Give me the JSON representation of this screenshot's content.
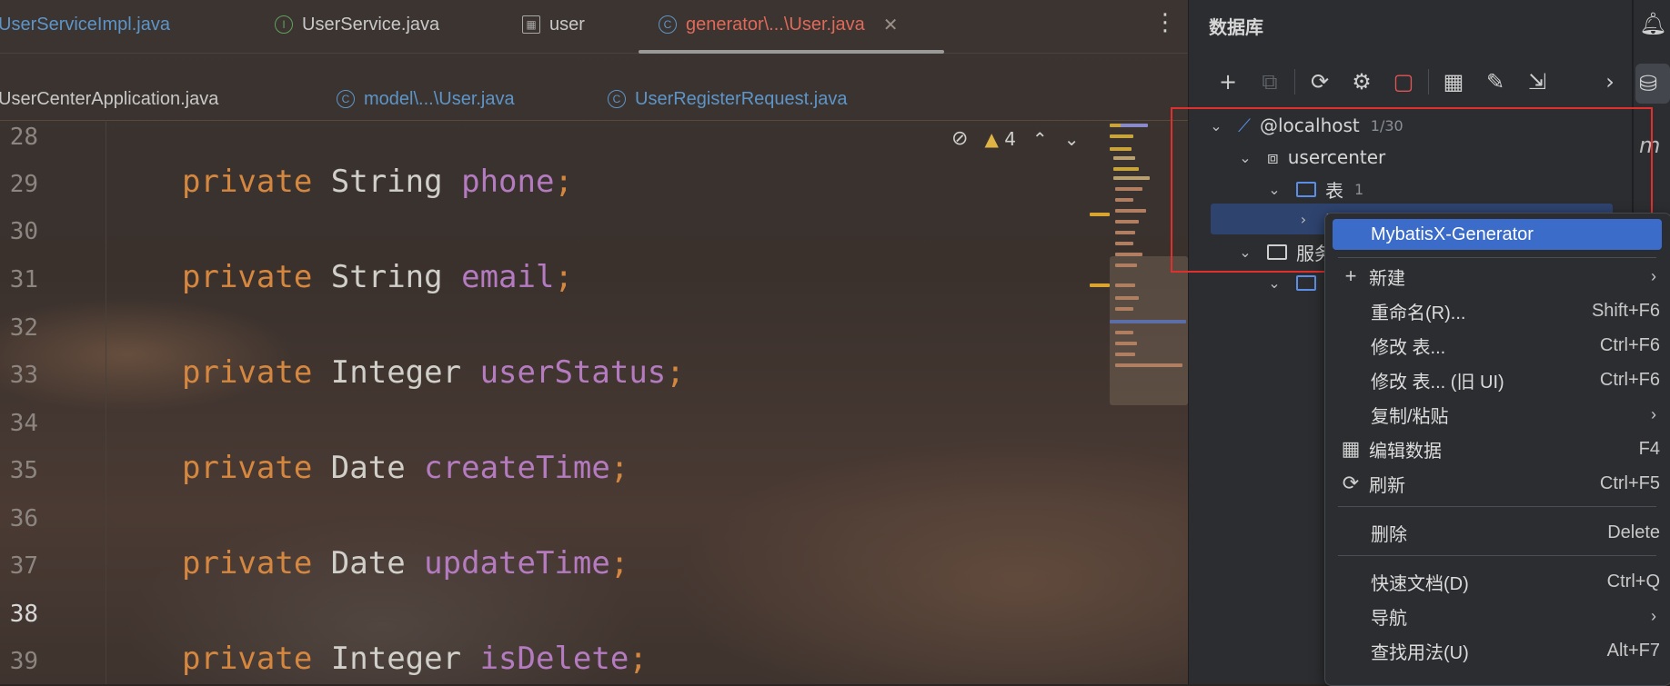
{
  "editor": {
    "tabs_row1": [
      {
        "label": "UserServiceImpl.java",
        "icon": "class-icon"
      },
      {
        "label": "UserService.java",
        "icon": "interface-icon"
      },
      {
        "label": "user",
        "icon": "table-icon"
      },
      {
        "label": "generator\\...\\User.java",
        "icon": "class-icon",
        "active": true
      }
    ],
    "tabs_row2": [
      {
        "label": "UserCenterApplication.java"
      },
      {
        "label": "model\\...\\User.java",
        "icon": "class-icon"
      },
      {
        "label": "UserRegisterRequest.java",
        "icon": "class-icon"
      }
    ],
    "inspection": {
      "warnings": "4"
    },
    "lines": [
      {
        "no": "28",
        "code": null
      },
      {
        "no": "29",
        "kw": "private",
        "type": "String",
        "field": "phone"
      },
      {
        "no": "30",
        "code": null
      },
      {
        "no": "31",
        "kw": "private",
        "type": "String",
        "field": "email"
      },
      {
        "no": "32",
        "code": null
      },
      {
        "no": "33",
        "kw": "private",
        "type": "Integer",
        "field": "userStatus"
      },
      {
        "no": "34",
        "code": null
      },
      {
        "no": "35",
        "kw": "private",
        "type": "Date",
        "field": "createTime"
      },
      {
        "no": "36",
        "code": null
      },
      {
        "no": "37",
        "kw": "private",
        "type": "Date",
        "field": "updateTime"
      },
      {
        "no": "38",
        "code": null,
        "current": true
      },
      {
        "no": "39",
        "kw": "private",
        "type": "Integer",
        "field": "isDelete"
      }
    ]
  },
  "database": {
    "title": "数据库",
    "tree": {
      "host": "@localhost",
      "host_count": "1/30",
      "schema": "usercenter",
      "tables_folder": "表",
      "tables_count": "1",
      "services_folder": "服务"
    }
  },
  "context_menu": {
    "items": [
      {
        "label": "MybatisX-Generator",
        "highlight": true
      },
      {
        "label": "新建",
        "icon": "plus-icon",
        "submenu": true
      },
      {
        "label": "重命名(R)...",
        "shortcut": "Shift+F6"
      },
      {
        "label": "修改 表...",
        "shortcut": "Ctrl+F6"
      },
      {
        "label": "修改 表... (旧 UI)",
        "shortcut": "Ctrl+F6"
      },
      {
        "label": "复制/粘贴",
        "submenu": true
      },
      {
        "label": "编辑数据",
        "icon": "table-grid-icon",
        "shortcut": "F4"
      },
      {
        "label": "刷新",
        "icon": "refresh-icon",
        "shortcut": "Ctrl+F5"
      },
      {
        "label": "删除",
        "shortcut": "Delete"
      },
      {
        "label": "快速文档(D)",
        "shortcut": "Ctrl+Q"
      },
      {
        "label": "导航",
        "submenu": true
      },
      {
        "label": "查找用法(U)",
        "shortcut": "Alt+F7"
      }
    ]
  },
  "colors": {
    "keyword": "#d6873f",
    "field": "#b47bc0",
    "tab_link": "#5d95c9",
    "tab_active": "#e06a5a",
    "menu_highlight": "#3b6cc9",
    "annotation_box": "#e0302e"
  }
}
